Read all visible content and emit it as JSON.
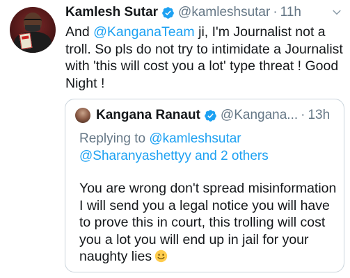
{
  "tweet": {
    "author_name": "Kamlesh Sutar",
    "author_handle": "@kamleshsutar",
    "separator": "·",
    "time": "11h",
    "body": {
      "prefix": "And ",
      "mention": "@KanganaTeam",
      "text": " ji,  I'm Journalist not a troll. So pls do not try to intimidate a Journalist with 'this will cost you a lot' type threat ! Good Night !"
    }
  },
  "quoted_tweet": {
    "author_name": "Kangana Ranaut",
    "author_handle": "@Kangana...",
    "separator": "·",
    "time": "13h",
    "replying_prefix": "Replying to ",
    "replying_to": "@kamleshsutar",
    "replying_more": "@Sharanyashettyy",
    "replying_suffix": " and 2 others",
    "text": "You are wrong don't spread misinformation I will send you a legal notice you will have to prove this in court, this trolling will cost you a lot you will end up in jail for your naughty lies",
    "emoji": "slightly-smiling-face"
  },
  "colors": {
    "link": "#1da1f2",
    "verified": "#1da1f2",
    "muted": "#657786",
    "border": "#c9d3db"
  },
  "icons": [
    "verified-badge-icon",
    "chevron-down-icon",
    "slightly-smiling-face-emoji"
  ]
}
